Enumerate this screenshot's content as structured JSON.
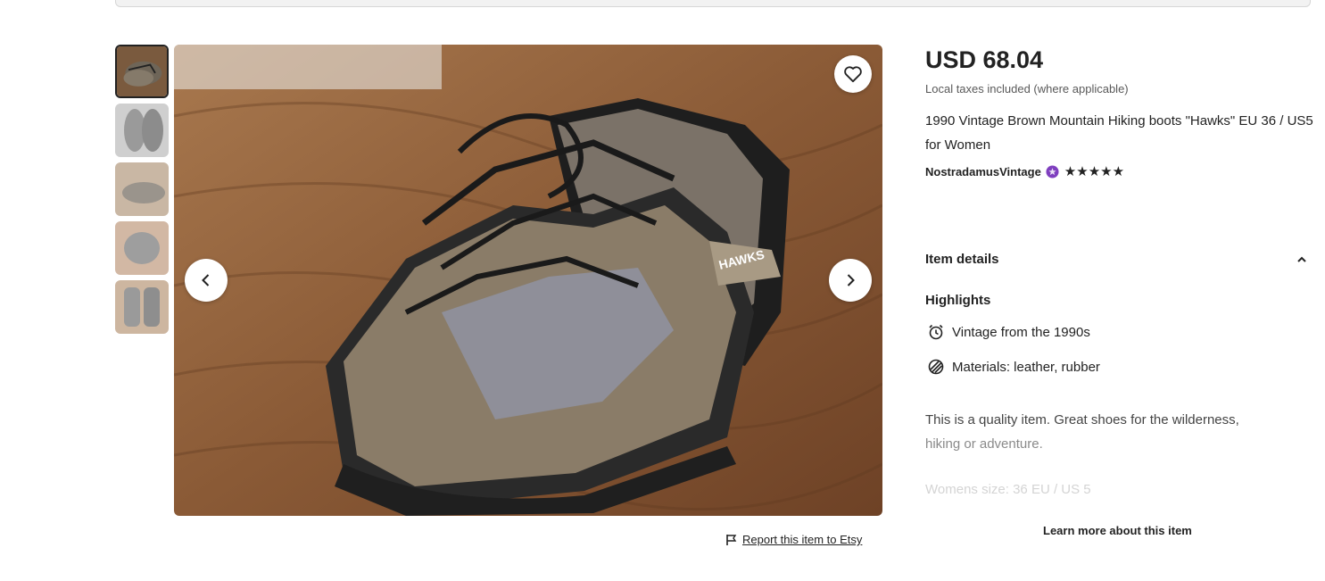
{
  "listing": {
    "price": "USD 68.04",
    "tax_note": "Local taxes included (where applicable)",
    "title": "1990 Vintage Brown Mountain Hiking boots \"Hawks\" EU 36 / US5 for Women",
    "shop_name": "NostradamusVintage",
    "rating_stars": 5,
    "stars_text": "★★★★★"
  },
  "gallery": {
    "thumbnail_count": 5,
    "active_index": 0,
    "boot_brand_text": "HAWKS"
  },
  "item_details": {
    "header": "Item details",
    "highlights_title": "Highlights",
    "highlights": [
      {
        "icon": "alarm-clock-icon",
        "text": "Vintage from the 1990s"
      },
      {
        "icon": "materials-icon",
        "text": "Materials: leather, rubber"
      }
    ],
    "description_line1": "This is a quality item. Great shoes for the wilderness,",
    "description_line2": "hiking or adventure.",
    "size_text": "Womens size: 36 EU / US 5",
    "learn_more": "Learn more about this item"
  },
  "report_link": "Report this item to Etsy",
  "colors": {
    "text": "#222222",
    "muted": "#595959",
    "star_seller_badge": "#7f3fbf",
    "wood": "#8a5a36"
  }
}
